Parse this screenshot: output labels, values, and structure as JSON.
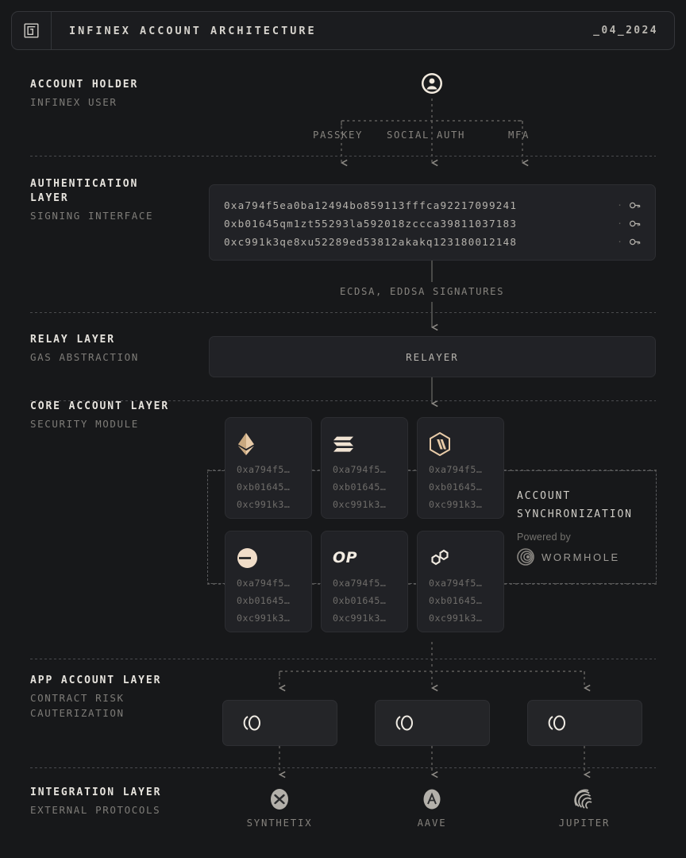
{
  "header": {
    "logo_icon": "infinex-spiral-logo",
    "title": "INFINEX ACCOUNT ARCHITECTURE",
    "date": "_04_2024"
  },
  "rows": {
    "account_holder": {
      "title": "ACCOUNT HOLDER",
      "subtitle": "INFINEX USER",
      "avatar_icon": "user-avatar-icon"
    },
    "authentication": {
      "title": "AUTHENTICATION\nLAYER",
      "subtitle": "SIGNING INTERFACE"
    },
    "relay": {
      "title": "RELAY LAYER",
      "subtitle": "GAS ABSTRACTION",
      "box_label": "RELAYER"
    },
    "core_account": {
      "title": "CORE ACCOUNT LAYER",
      "subtitle": "SECURITY MODULE"
    },
    "app_account": {
      "title": "APP ACCOUNT LAYER",
      "subtitle": "CONTRACT RISK\nCAUTERIZATION"
    },
    "integration": {
      "title": "INTEGRATION LAYER",
      "subtitle": "EXTERNAL PROTOCOLS"
    }
  },
  "auth_methods": [
    {
      "label": "PASSKEY"
    },
    {
      "label": "SOCIAL AUTH"
    },
    {
      "label": "MFA"
    }
  ],
  "auth_addresses": [
    {
      "address": "0xa794f5ea0ba12494bo859113fffca92217099241",
      "icon": "key-icon"
    },
    {
      "address": "0xb01645qm1zt55293la592018zccca39811037183",
      "icon": "key-icon"
    },
    {
      "address": "0xc991k3qe8xu52289ed53812akakq123180012148",
      "icon": "key-icon"
    }
  ],
  "signature_label": "ECDSA, EDDSA SIGNATURES",
  "chains": [
    {
      "name": "ethereum",
      "icon": "ethereum-logo-icon",
      "addresses": [
        "0xa794f5…",
        "0xb01645…",
        "0xc991k3…"
      ]
    },
    {
      "name": "solana",
      "icon": "solana-logo-icon",
      "addresses": [
        "0xa794f5…",
        "0xb01645…",
        "0xc991k3…"
      ]
    },
    {
      "name": "arbitrum",
      "icon": "arbitrum-logo-icon",
      "addresses": [
        "0xa794f5…",
        "0xb01645…",
        "0xc991k3…"
      ]
    },
    {
      "name": "base",
      "icon": "base-logo-icon",
      "addresses": [
        "0xa794f5…",
        "0xb01645…",
        "0xc991k3…"
      ]
    },
    {
      "name": "optimism",
      "icon": "optimism-logo-icon",
      "addresses": [
        "0xa794f5…",
        "0xb01645…",
        "0xc991k3…"
      ]
    },
    {
      "name": "polygon",
      "icon": "polygon-logo-icon",
      "addresses": [
        "0xa794f5…",
        "0xb01645…",
        "0xc991k3…"
      ]
    }
  ],
  "sync": {
    "title_line1": "ACCOUNT",
    "title_line2": "SYNCHRONIZATION",
    "powered_by": "Powered by",
    "provider": "WORMHOLE",
    "provider_icon": "wormhole-logo-icon"
  },
  "app_accounts": [
    {
      "icon": "infinex-app-icon"
    },
    {
      "icon": "infinex-app-icon"
    },
    {
      "icon": "infinex-app-icon"
    }
  ],
  "integrations": [
    {
      "name": "SYNTHETIX",
      "icon": "synthetix-logo-icon"
    },
    {
      "name": "AAVE",
      "icon": "aave-logo-icon"
    },
    {
      "name": "JUPITER",
      "icon": "jupiter-logo-icon"
    }
  ],
  "colors": {
    "background": "#17181a",
    "panel": "#212226",
    "border": "#2d2e32",
    "text_primary": "#e6e3dd",
    "text_muted": "#7e7c78",
    "accent_gold": "#e8cba8"
  }
}
